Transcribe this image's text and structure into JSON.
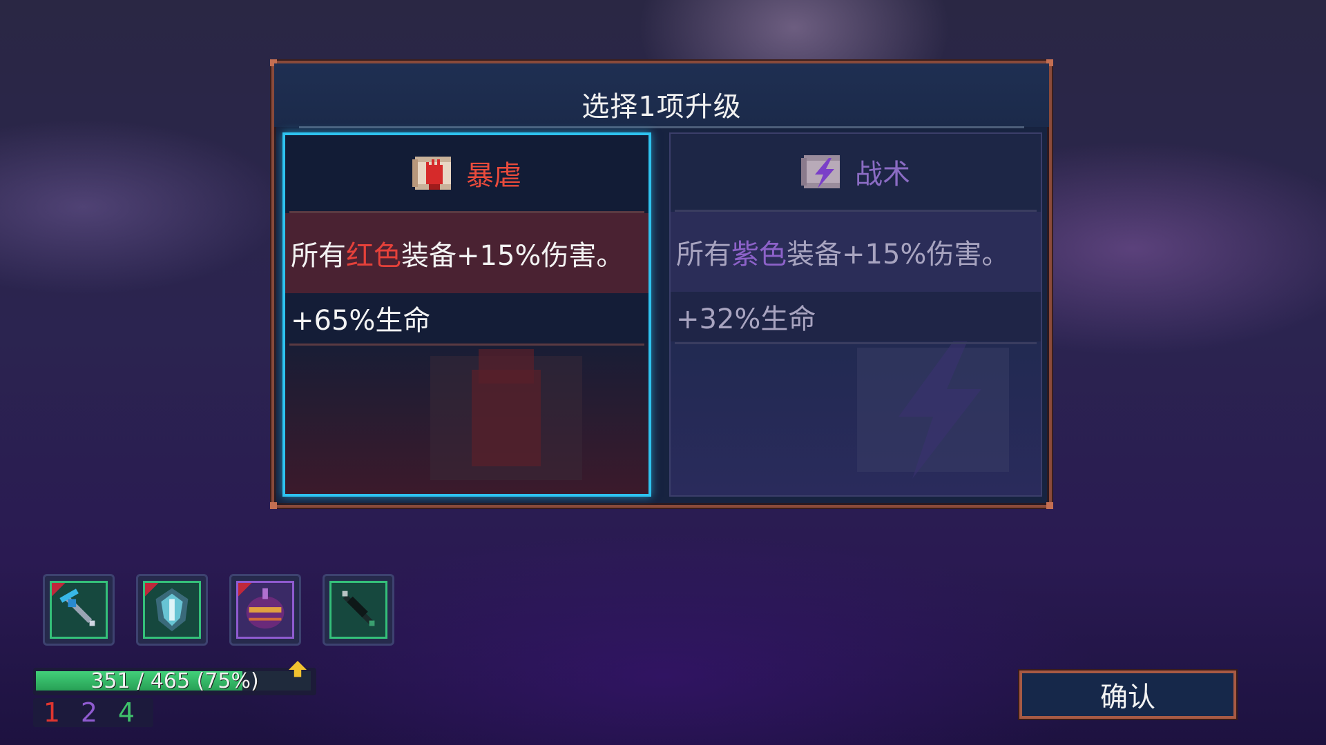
{
  "dialog": {
    "title": "选择1项升级"
  },
  "options": [
    {
      "name": "暴虐",
      "icon": "red-fist-scroll-icon",
      "color": "#ea4b3c",
      "effect_prefix": "所有",
      "effect_highlight": "红色",
      "effect_suffix": "装备+15%伤害。",
      "stat": "+65%生命",
      "selected": true
    },
    {
      "name": "战术",
      "icon": "purple-lightning-scroll-icon",
      "color": "#8b6cc4",
      "effect_prefix": "所有",
      "effect_highlight": "紫色",
      "effect_suffix": "装备+15%伤害。",
      "stat": "+32%生命",
      "selected": false
    }
  ],
  "equipment": [
    {
      "icon": "ice-crossbow-icon",
      "rarity": "green"
    },
    {
      "icon": "crystal-shield-icon",
      "rarity": "green"
    },
    {
      "icon": "purple-grenade-icon",
      "rarity": "purple"
    },
    {
      "icon": "dark-blade-icon",
      "rarity": "green"
    }
  ],
  "health": {
    "text": "351 / 465 (75%)",
    "fraction": 0.75
  },
  "scroll_counts": [
    {
      "value": "1",
      "color": "#e0352f"
    },
    {
      "value": "2",
      "color": "#8f5bd0"
    },
    {
      "value": "4",
      "color": "#3fc26b"
    }
  ],
  "confirm_label": "确认"
}
